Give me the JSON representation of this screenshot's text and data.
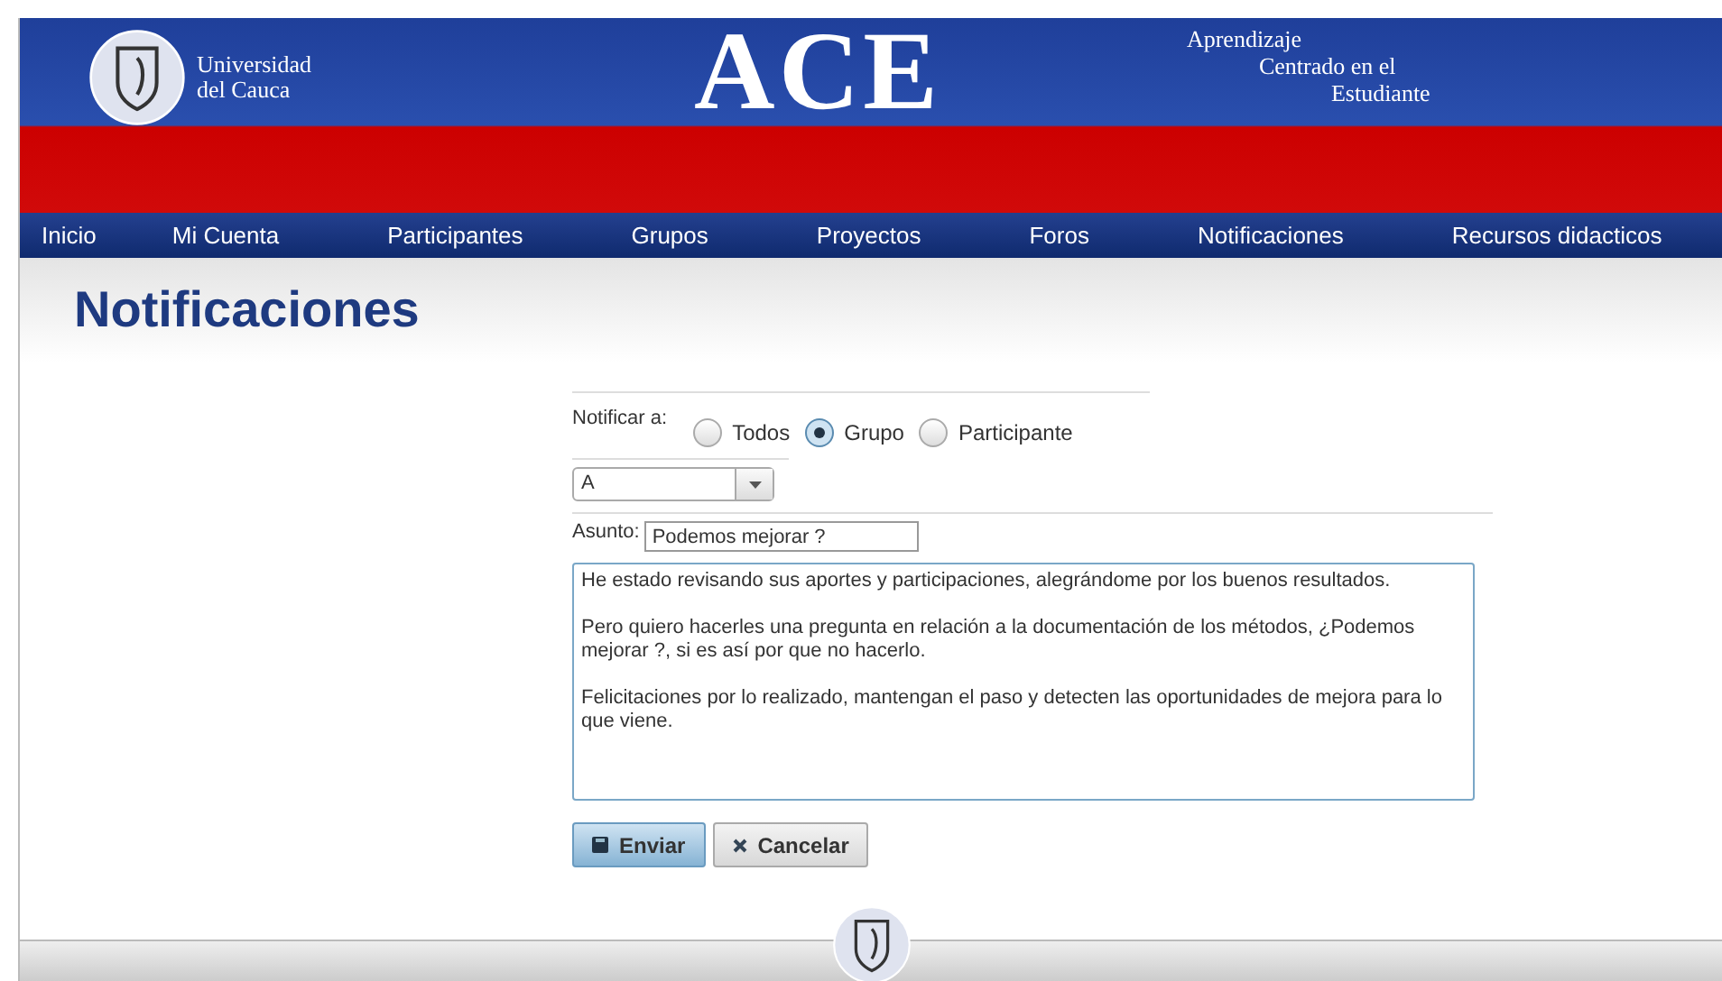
{
  "header": {
    "university": [
      "Universidad",
      "del Cauca"
    ],
    "logo": "ACE",
    "tagline": [
      "Aprendizaje",
      "Centrado en el",
      "Estudiante"
    ]
  },
  "nav": [
    "Inicio",
    "Mi Cuenta",
    "Participantes",
    "Grupos",
    "Proyectos",
    "Foros",
    "Notificaciones",
    "Recursos didacticos"
  ],
  "page_title": "Notificaciones",
  "form": {
    "notify_label": "Notificar a:",
    "options": [
      {
        "label": "Todos",
        "selected": false
      },
      {
        "label": "Grupo",
        "selected": true
      },
      {
        "label": "Participante",
        "selected": false
      }
    ],
    "group_select": {
      "value": "A"
    },
    "subject_label": "Asunto:",
    "subject": {
      "value": "Podemos mejorar ?"
    },
    "message": {
      "value": "He estado revisando sus aportes y participaciones, alegrándome por los buenos resultados.\n\nPero quiero hacerles una pregunta en relación a la documentación de los métodos, ¿Podemos mejorar ?, si es así por que no hacerlo.\n\nFelicitaciones por lo realizado, mantengan el paso y detecten las oportunidades de mejora para lo que viene."
    },
    "buttons": [
      {
        "kind": "send",
        "label": "Enviar"
      },
      {
        "kind": "cancel",
        "label": "Cancelar"
      }
    ]
  }
}
